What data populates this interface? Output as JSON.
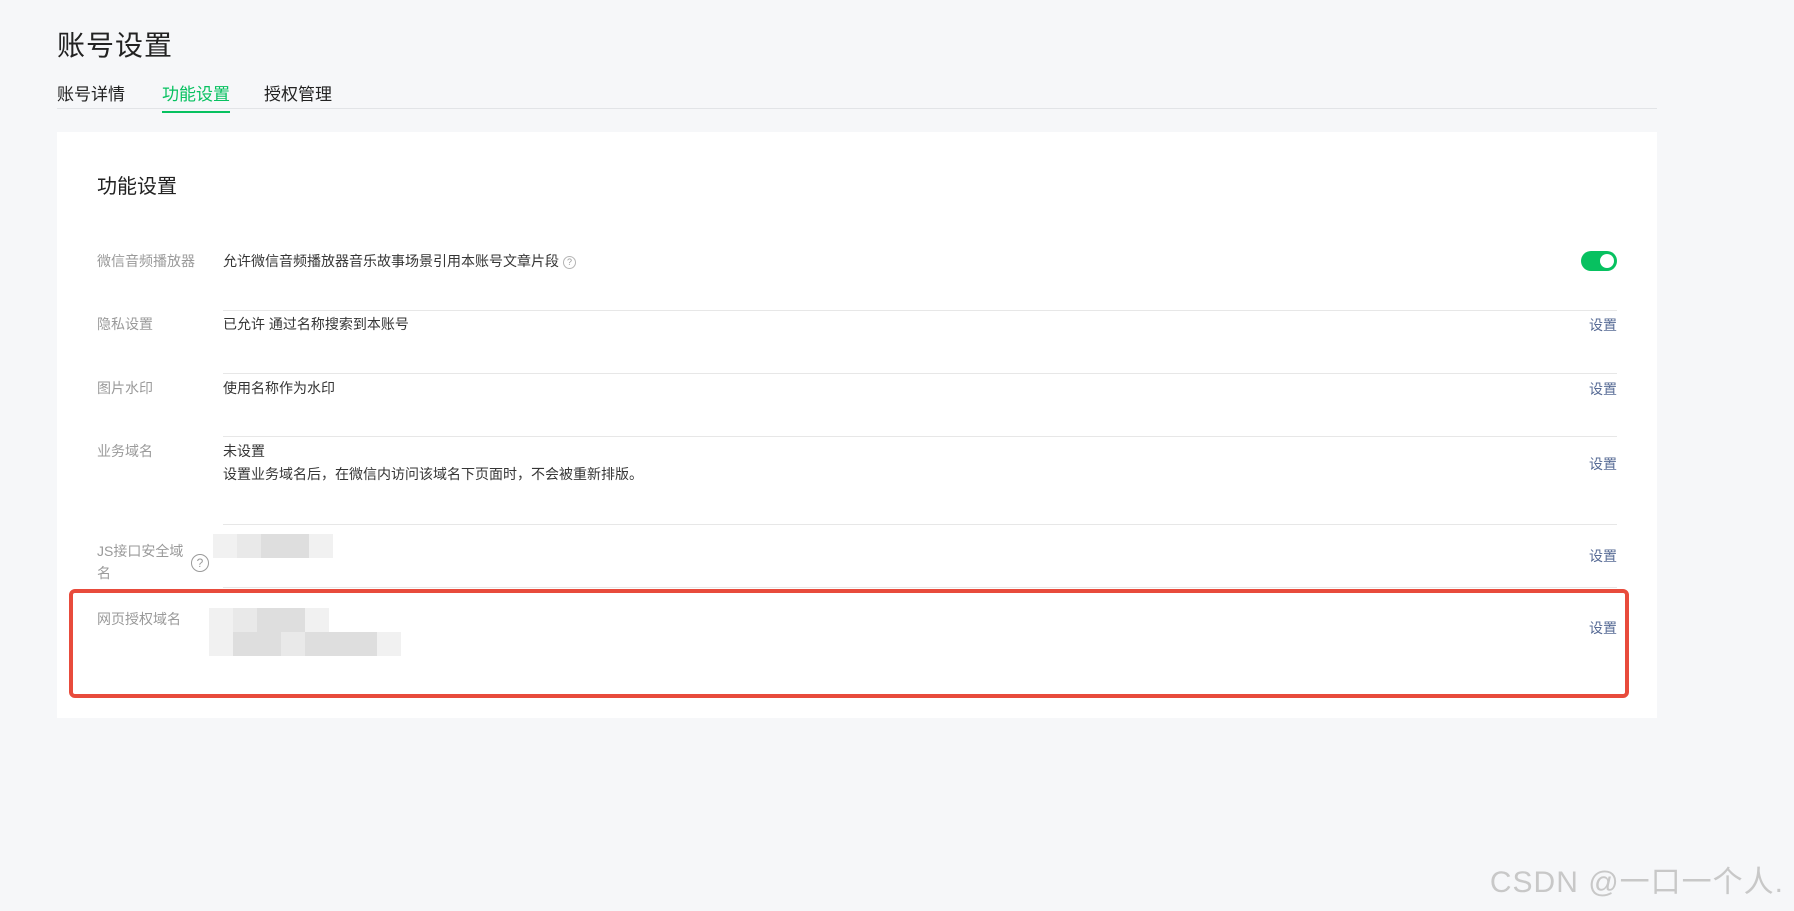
{
  "page": {
    "title": "账号设置",
    "accent_color": "#07c160",
    "link_color": "#576b95",
    "highlight_color": "#e84b3c"
  },
  "tabs": [
    {
      "label": "账号详情",
      "active": false
    },
    {
      "label": "功能设置",
      "active": true
    },
    {
      "label": "授权管理",
      "active": false
    }
  ],
  "section": {
    "title": "功能设置",
    "rows": [
      {
        "label": "微信音频播放器",
        "value": "允许微信音频播放器音乐故事场景引用本账号文章片段",
        "help_icon": "?",
        "control": "toggle",
        "toggle_on": true
      },
      {
        "label": "隐私设置",
        "value": "已允许 通过名称搜索到本账号",
        "action": "设置"
      },
      {
        "label": "图片水印",
        "value": "使用名称作为水印",
        "action": "设置"
      },
      {
        "label": "业务域名",
        "value": "未设置",
        "description": "设置业务域名后，在微信内访问该域名下页面时，不会被重新排版。",
        "action": "设置"
      },
      {
        "label_line1": "JS接口安全域",
        "label_line2": "名",
        "help_icon": "?",
        "value_redacted": true,
        "action": "设置"
      },
      {
        "label": "网页授权域名",
        "value_redacted": true,
        "highlighted": true,
        "action": "设置"
      }
    ]
  },
  "watermark": "CSDN @一口一个人."
}
